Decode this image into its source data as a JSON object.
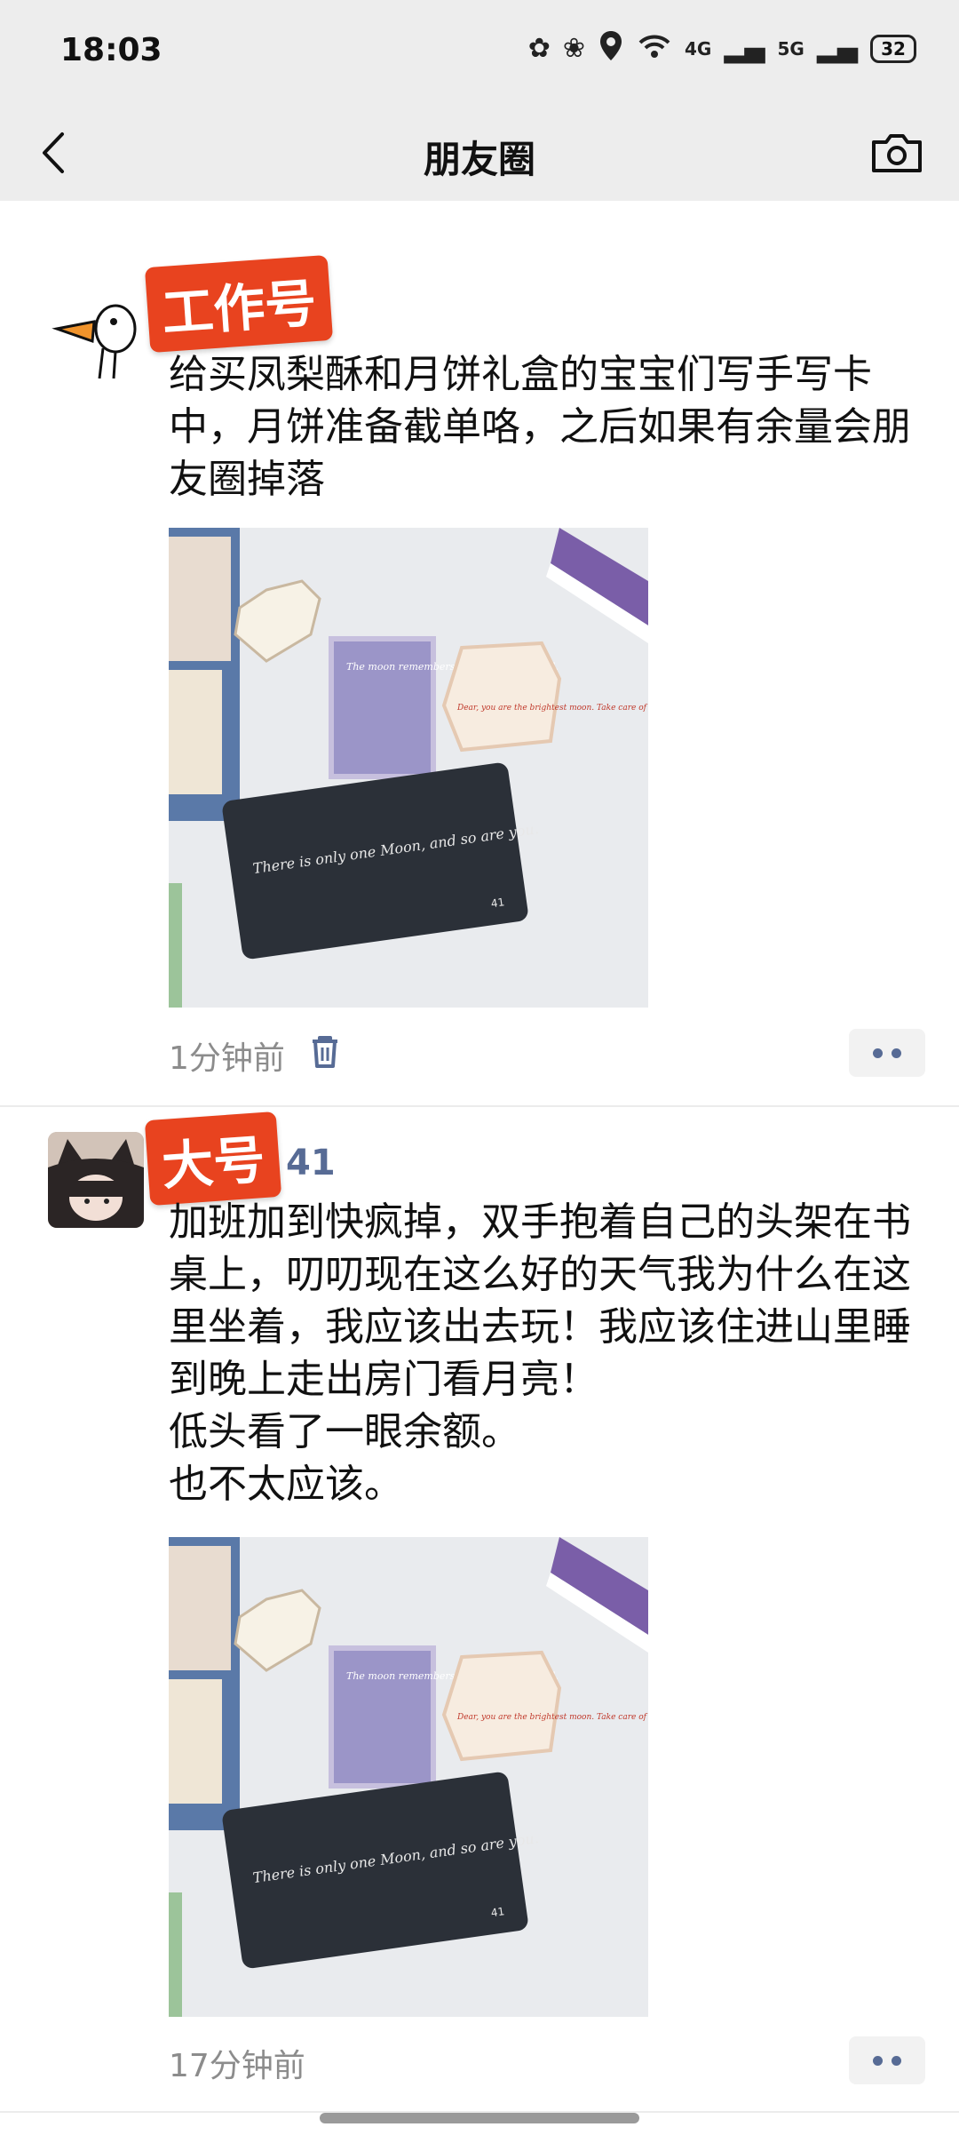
{
  "status_bar": {
    "time": "18:03",
    "signal_4g": "4G",
    "signal_5g": "5G",
    "battery": "32",
    "icons": [
      "paw-icon",
      "flower-icon",
      "location-icon",
      "wifi-icon",
      "cat-icon"
    ]
  },
  "header": {
    "title": "朋友圈",
    "back_icon": "chevron-left-icon",
    "camera_icon": "camera-icon"
  },
  "posts": [
    {
      "tag": "工作号",
      "nickname": "",
      "text": "给买凤梨酥和月饼礼盒的宝宝们写手写卡中，月饼准备截单咯，之后如果有余量会朋友圈掉落",
      "image": {
        "card_main": "There is only one Moon, and so are you.",
        "card_num": "41",
        "card_purple": "The moon remembers everything you said.",
        "card_cream": "Dear, you are the brightest moon. Take care of yourself."
      },
      "time_ago": "1分钟前",
      "has_delete": true
    },
    {
      "tag": "大号",
      "nickname": "41",
      "text": "加班加到快疯掉，双手抱着自己的头架在书桌上，叨叨现在这么好的天气我为什么在这里坐着，我应该出去玩！我应该住进山里睡到晚上走出房门看月亮！\n低头看了一眼余额。\n也不太应该。",
      "image": {
        "card_main": "There is only one Moon, and so are you.",
        "card_num": "41",
        "card_purple": "The moon remembers everything you said.",
        "card_cream": "Dear, you are the brightest moon. Take care of yourself."
      },
      "time_ago": "17分钟前",
      "has_delete": false
    }
  ]
}
